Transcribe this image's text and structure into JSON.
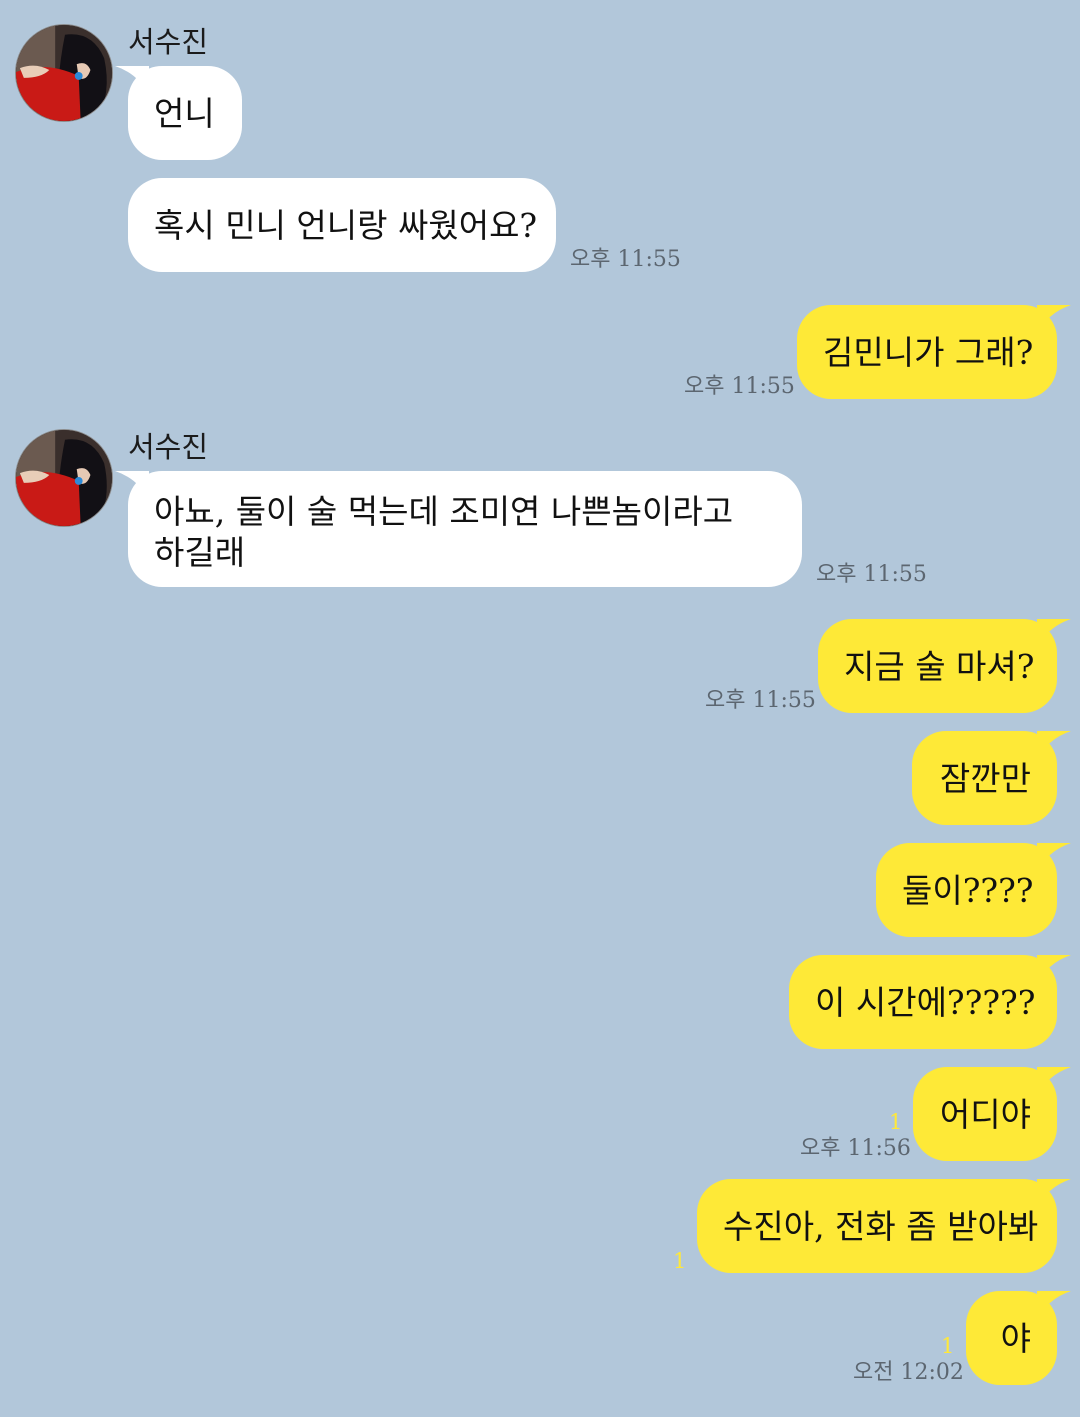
{
  "chat": {
    "partner_name": "서수진",
    "messages": [
      {
        "text": "언니",
        "time": ""
      },
      {
        "text": "혹시 민니 언니랑 싸웠어요?",
        "time": "오후 11:55"
      },
      {
        "text": "김민니가 그래?",
        "time": "오후 11:55"
      },
      {
        "text": "아뇨, 둘이 술 먹는데 조미연 나쁜놈이라고\n하길래",
        "time": "오후 11:55"
      },
      {
        "text": "지금 술 마셔?",
        "time": "오후 11:55"
      },
      {
        "text": "잠깐만",
        "time": ""
      },
      {
        "text": "둘이????",
        "time": ""
      },
      {
        "text": "이 시간에?????",
        "time": ""
      },
      {
        "text": "어디야",
        "time": "오후 11:56",
        "unread": "1"
      },
      {
        "text": "수진아, 전화 좀 받아봐",
        "time": "",
        "unread": "1"
      },
      {
        "text": "야",
        "time": "오전 12:02",
        "unread": "1"
      }
    ]
  },
  "colors": {
    "background": "#b2c7da",
    "incoming_bubble": "#ffffff",
    "outgoing_bubble": "#fee937",
    "unread_count": "#ffe83a",
    "timestamp": "#5c6670"
  },
  "icons": {
    "avatar": "profile-photo"
  }
}
